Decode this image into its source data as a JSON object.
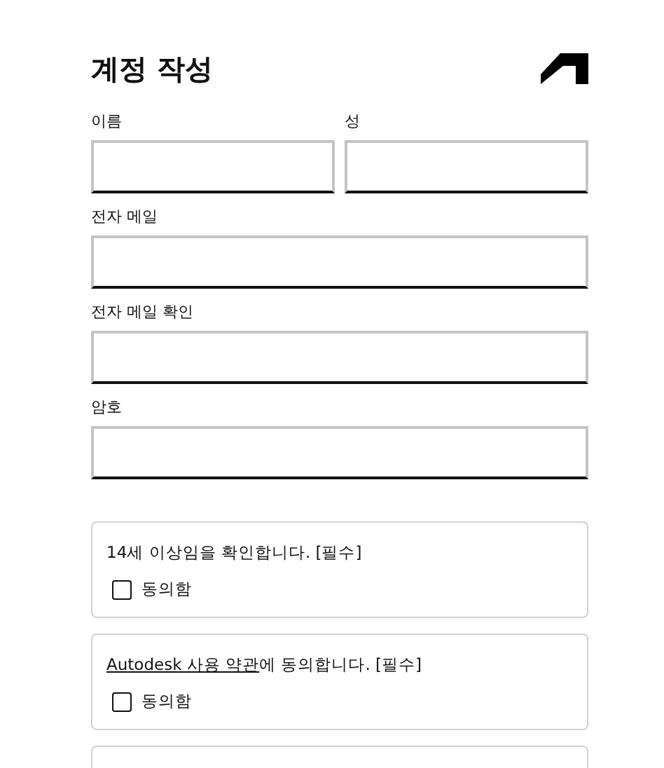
{
  "title": "계정 작성",
  "name_fields": [
    {
      "label": "이름"
    },
    {
      "label": "성"
    }
  ],
  "fields": [
    {
      "label": "전자 메일"
    },
    {
      "label": "전자 메일 확인"
    },
    {
      "label": "암호"
    }
  ],
  "consents": [
    {
      "text": "14세 이상임을 확인합니다. [필수]",
      "checkbox_label": "동의함",
      "checked": false
    },
    {
      "link": "Autodesk 사용 약관",
      "text": "에 동의합니다. [필수]",
      "checkbox_label": "동의함",
      "checked": false
    }
  ]
}
